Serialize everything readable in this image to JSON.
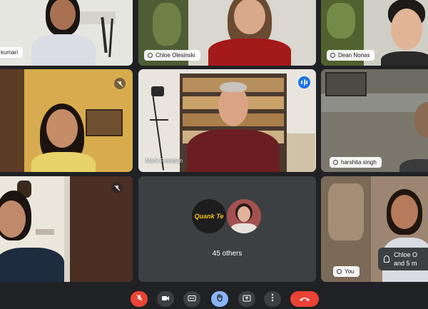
{
  "participants": [
    {
      "name": "kumari"
    },
    {
      "name": "Chloe Olesinski"
    },
    {
      "name": "Dean Nonas"
    },
    {
      "name": ""
    },
    {
      "name": "Mark Freeman"
    },
    {
      "name": "harshita singh"
    },
    {
      "name": ""
    },
    {
      "name": "You"
    }
  ],
  "others": {
    "label": "45 others",
    "logo_text": "Quank Te"
  },
  "toast": {
    "line1": "Chloe O",
    "line2": "and 5 m"
  },
  "controls": {
    "mic_icon": "mic-off-icon",
    "camera_icon": "camera-icon",
    "captions_icon": "captions-icon",
    "hand_icon": "raise-hand-icon",
    "present_icon": "present-screen-icon",
    "more_icon": "more-options-icon",
    "leave_icon": "leave-call-icon"
  },
  "colors": {
    "background": "#202124",
    "leave": "#ea4335",
    "hand": "#8ab4f8",
    "speaking": "#1a73e8"
  }
}
